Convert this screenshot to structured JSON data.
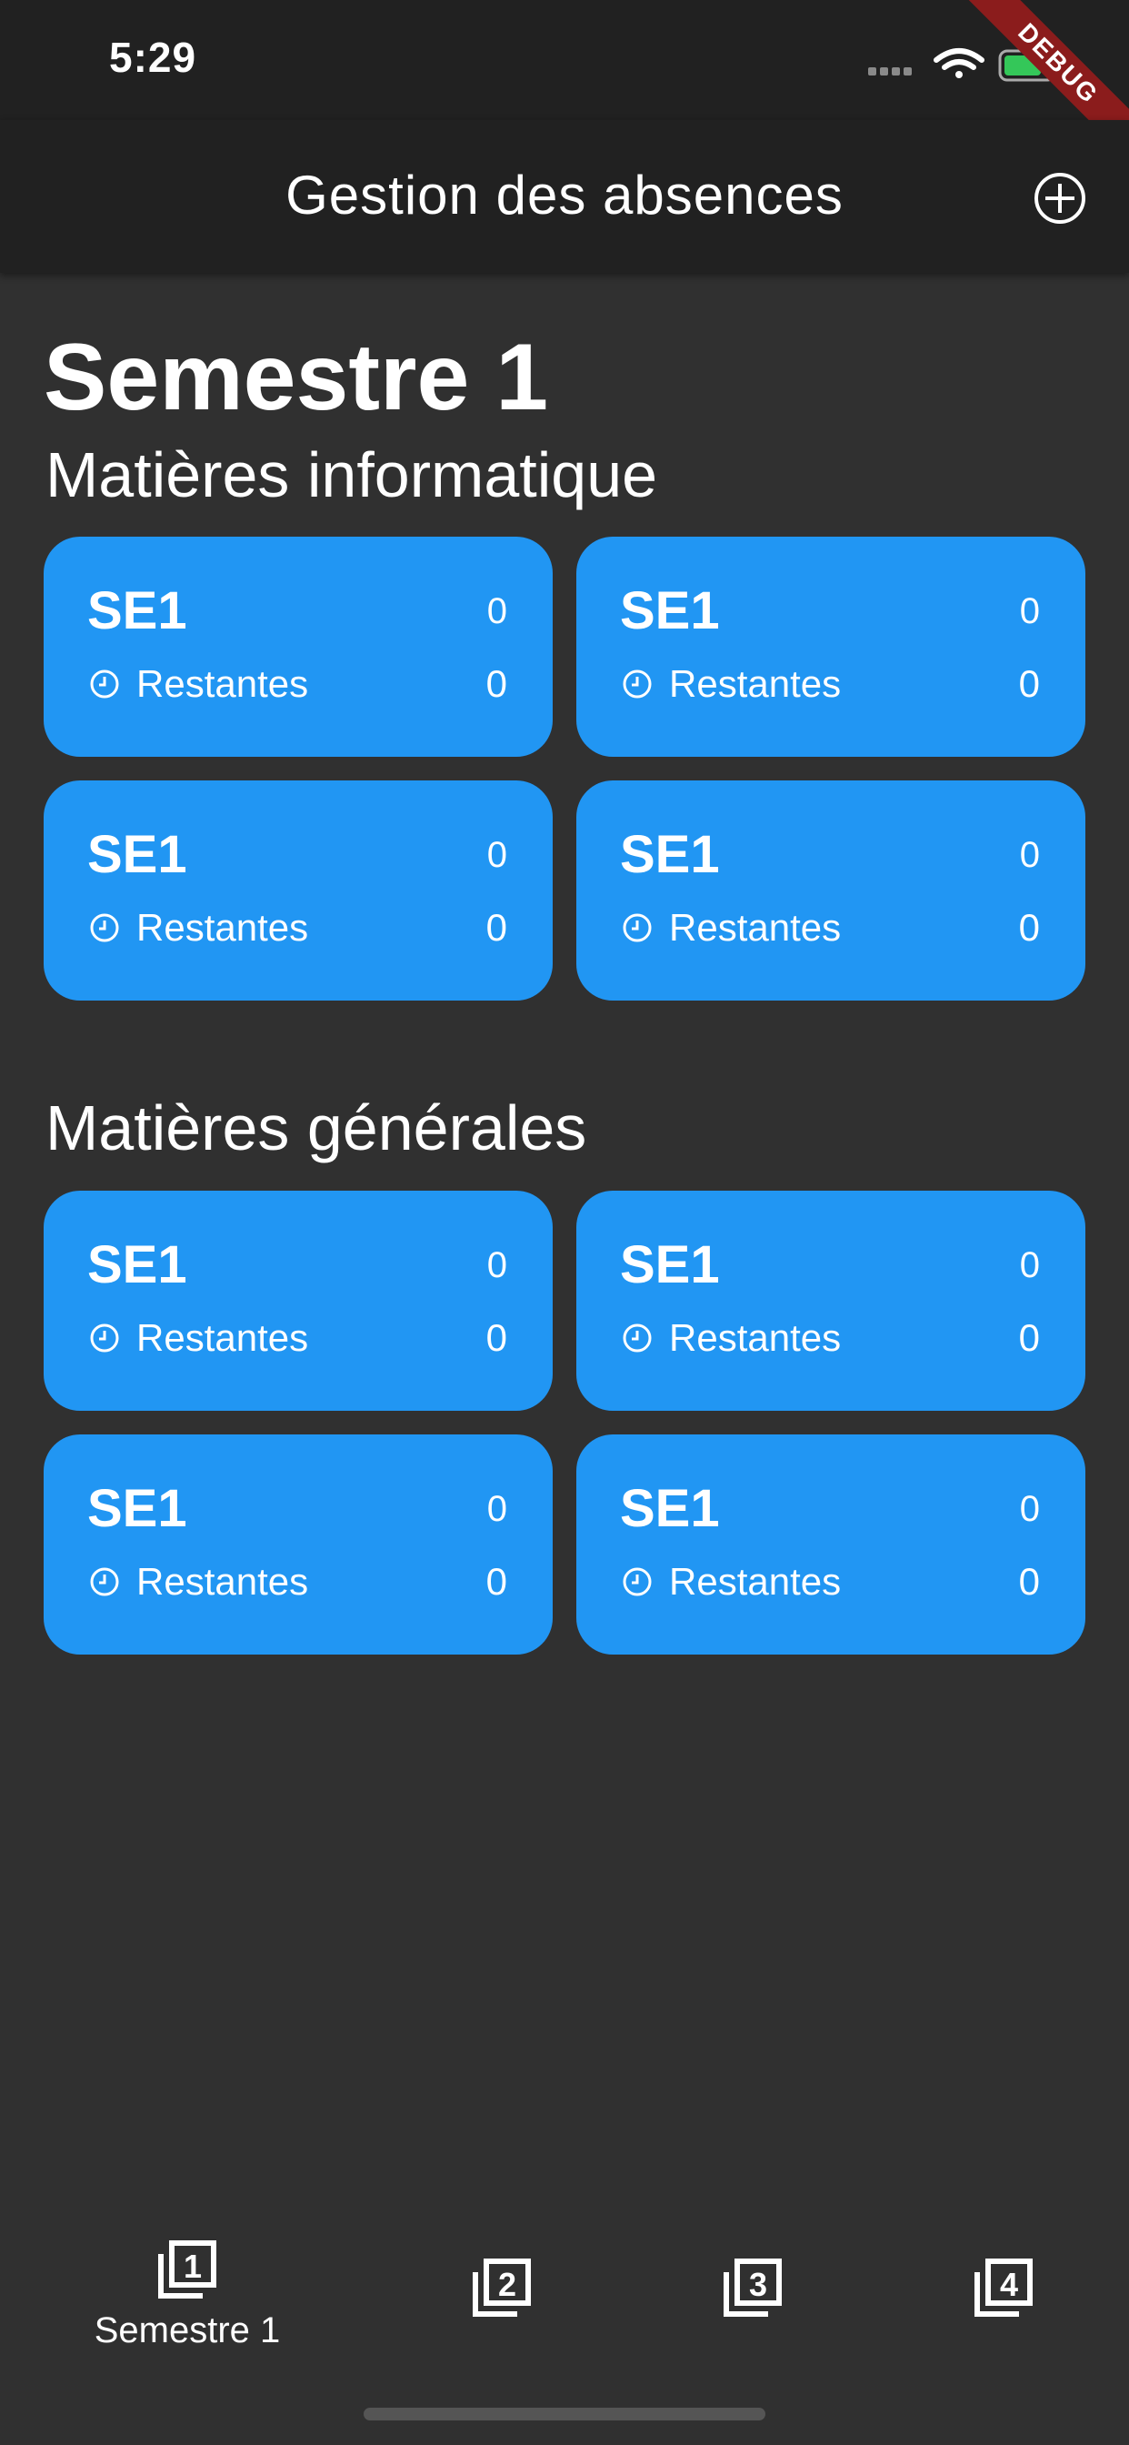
{
  "status_bar": {
    "time": "5:29"
  },
  "debug_banner": "DEBUG",
  "app_bar": {
    "title": "Gestion des absences",
    "add_icon": "plus-circle-icon"
  },
  "semester": {
    "title": "Semestre 1"
  },
  "sections": [
    {
      "title": "Matières informatique",
      "cards": [
        {
          "name": "SE1",
          "count": "0",
          "rest_label": "Restantes",
          "rest_value": "0"
        },
        {
          "name": "SE1",
          "count": "0",
          "rest_label": "Restantes",
          "rest_value": "0"
        },
        {
          "name": "SE1",
          "count": "0",
          "rest_label": "Restantes",
          "rest_value": "0"
        },
        {
          "name": "SE1",
          "count": "0",
          "rest_label": "Restantes",
          "rest_value": "0"
        }
      ]
    },
    {
      "title": "Matières générales",
      "cards": [
        {
          "name": "SE1",
          "count": "0",
          "rest_label": "Restantes",
          "rest_value": "0"
        },
        {
          "name": "SE1",
          "count": "0",
          "rest_label": "Restantes",
          "rest_value": "0"
        },
        {
          "name": "SE1",
          "count": "0",
          "rest_label": "Restantes",
          "rest_value": "0"
        },
        {
          "name": "SE1",
          "count": "0",
          "rest_label": "Restantes",
          "rest_value": "0"
        }
      ]
    }
  ],
  "bottom_nav": {
    "items": [
      {
        "label": "Semestre 1",
        "icon": "filter-1-icon",
        "selected": true
      },
      {
        "label": "",
        "icon": "filter-2-icon",
        "selected": false
      },
      {
        "label": "",
        "icon": "filter-3-icon",
        "selected": false
      },
      {
        "label": "",
        "icon": "filter-4-icon",
        "selected": false
      }
    ]
  },
  "colors": {
    "background": "#303030",
    "app_bar": "#212121",
    "card": "#2196f3"
  }
}
